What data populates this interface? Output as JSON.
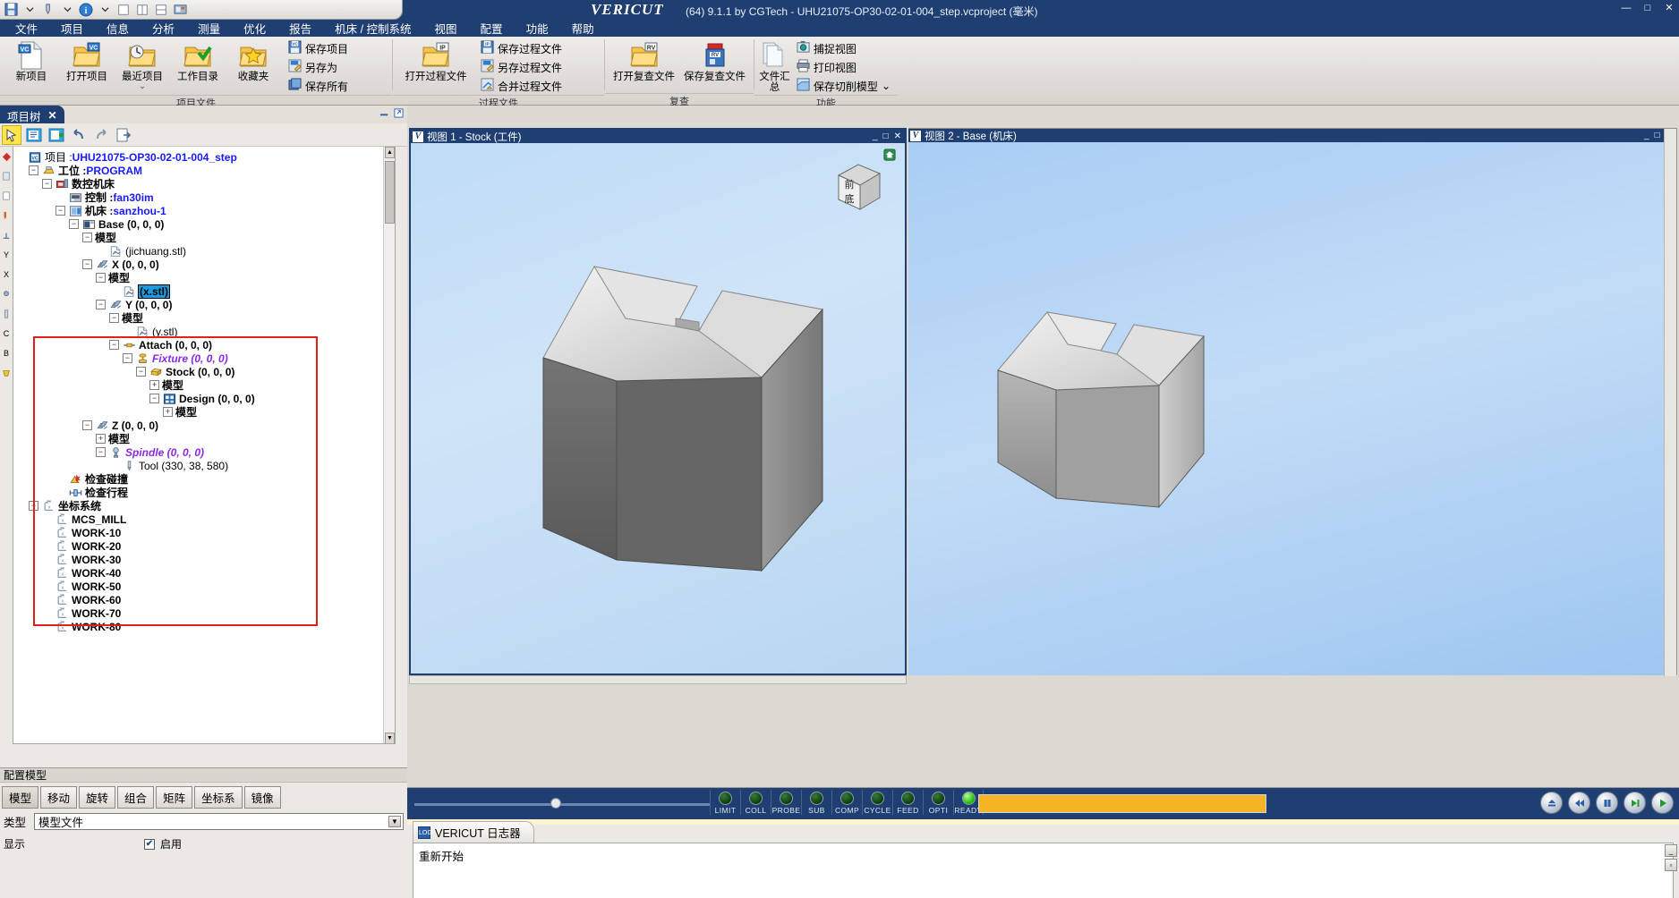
{
  "titlebar": {
    "brand": "VERICUT",
    "title": "(64) 9.1.1 by CGTech - UHU21075-OP30-02-01-004_step.vcproject (毫米)",
    "minimize": "—",
    "maximize": "□",
    "close": "✕"
  },
  "menubar": {
    "items": [
      {
        "label": "文件"
      },
      {
        "label": "项目"
      },
      {
        "label": "信息"
      },
      {
        "label": "分析"
      },
      {
        "label": "测量"
      },
      {
        "label": "优化"
      },
      {
        "label": "报告"
      },
      {
        "label": "机床 / 控制系统"
      },
      {
        "label": "视图"
      },
      {
        "label": "配置"
      },
      {
        "label": "功能"
      },
      {
        "label": "帮助"
      }
    ]
  },
  "ribbon": {
    "groups": [
      {
        "label": "项目文件",
        "big": [
          {
            "label": "新项目",
            "icon": "new-project-icon",
            "caret": false
          },
          {
            "label": "打开项目",
            "icon": "open-project-icon",
            "caret": false
          },
          {
            "label": "最近项目",
            "icon": "recent-project-icon",
            "caret": true
          },
          {
            "label": "工作目录",
            "icon": "work-directory-icon",
            "caret": false
          },
          {
            "label": "收藏夹",
            "icon": "favorites-icon",
            "caret": false
          }
        ],
        "small": [
          {
            "label": "保存项目",
            "icon": "save-project-icon"
          },
          {
            "label": "另存为",
            "icon": "save-as-icon"
          },
          {
            "label": "保存所有",
            "icon": "save-all-icon"
          }
        ]
      },
      {
        "label": "过程文件",
        "big": [
          {
            "label": "打开过程文件",
            "icon": "open-process-file-icon",
            "caret": false
          }
        ],
        "small": [
          {
            "label": "保存过程文件",
            "icon": "save-process-file-icon"
          },
          {
            "label": "另存过程文件",
            "icon": "save-as-process-file-icon"
          },
          {
            "label": "合并过程文件",
            "icon": "merge-process-file-icon"
          }
        ]
      },
      {
        "label": "复查",
        "big": [
          {
            "label": "打开复查文件",
            "icon": "open-review-file-icon",
            "caret": false
          },
          {
            "label": "保存复查文件",
            "icon": "save-review-file-icon",
            "caret": false
          }
        ],
        "small": []
      },
      {
        "label": "功能",
        "big": [
          {
            "label": "文件汇总",
            "icon": "file-summary-icon",
            "caret": false
          }
        ],
        "small": [
          {
            "label": "捕捉视图",
            "icon": "capture-view-icon"
          },
          {
            "label": "打印视图",
            "icon": "print-view-icon"
          },
          {
            "label": "保存切削模型",
            "icon": "save-cut-model-icon",
            "caret": true
          }
        ]
      }
    ]
  },
  "leftdock": {
    "tab_label": "项目树",
    "tab_close": "✕",
    "toolbar": [
      {
        "name": "pointer-tool-icon"
      },
      {
        "name": "edit-document-icon"
      },
      {
        "name": "add-document-icon"
      },
      {
        "name": "undo-icon"
      },
      {
        "name": "redo-icon"
      },
      {
        "name": "export-icon"
      }
    ],
    "tree": [
      {
        "indent": 0,
        "toggle": "",
        "icon": "project-icon",
        "label": "项目 : ",
        "value": "UHU21075-OP30-02-01-004_step",
        "style": "plain"
      },
      {
        "indent": 1,
        "toggle": "-",
        "icon": "setup-icon",
        "label": "工位 : ",
        "value": "PROGRAM",
        "style": "bold"
      },
      {
        "indent": 2,
        "toggle": "-",
        "icon": "machine-icon",
        "label": "数控机床",
        "value": "",
        "style": "bold"
      },
      {
        "indent": 3,
        "toggle": "",
        "icon": "control-icon",
        "label": "控制 : ",
        "value": "fan30im",
        "style": "bold"
      },
      {
        "indent": 3,
        "toggle": "-",
        "icon": "tool-machine-icon",
        "label": "机床 : ",
        "value": "sanzhou-1",
        "style": "bold"
      },
      {
        "indent": 4,
        "toggle": "-",
        "icon": "base-icon",
        "label": "Base (0, 0, 0)",
        "value": "",
        "style": "bold"
      },
      {
        "indent": 5,
        "toggle": "-",
        "icon": "",
        "label": "模型",
        "value": "",
        "style": "bold"
      },
      {
        "indent": 6,
        "toggle": "",
        "icon": "stl-file-icon",
        "label": "(jichuang.stl)",
        "value": "",
        "style": "plain"
      },
      {
        "indent": 5,
        "toggle": "-",
        "icon": "axis-icon",
        "label": "X (0, 0, 0)",
        "value": "",
        "style": "bold"
      },
      {
        "indent": 6,
        "toggle": "-",
        "icon": "",
        "label": "模型",
        "value": "",
        "style": "bold"
      },
      {
        "indent": 7,
        "toggle": "",
        "icon": "stl-file-icon",
        "label": "(x.stl)",
        "value": "",
        "style": "selected"
      },
      {
        "indent": 6,
        "toggle": "-",
        "icon": "axis-icon",
        "label": "Y (0, 0, 0)",
        "value": "",
        "style": "bold"
      },
      {
        "indent": 7,
        "toggle": "-",
        "icon": "",
        "label": "模型",
        "value": "",
        "style": "bold"
      },
      {
        "indent": 8,
        "toggle": "",
        "icon": "stl-file-icon",
        "label": "(y.stl)",
        "value": "",
        "style": "plain"
      },
      {
        "indent": 7,
        "toggle": "-",
        "icon": "attach-icon",
        "label": "Attach (0, 0, 0)",
        "value": "",
        "style": "bold"
      },
      {
        "indent": 8,
        "toggle": "-",
        "icon": "fixture-icon",
        "label": "Fixture (0, 0, 0)",
        "value": "",
        "style": "purple"
      },
      {
        "indent": 9,
        "toggle": "-",
        "icon": "stock-icon",
        "label": "Stock (0, 0, 0)",
        "value": "",
        "style": "bold"
      },
      {
        "indent": 10,
        "toggle": "+",
        "icon": "",
        "label": "模型",
        "value": "",
        "style": "bold"
      },
      {
        "indent": 10,
        "toggle": "-",
        "icon": "design-icon",
        "label": "Design (0, 0, 0)",
        "value": "",
        "style": "bold"
      },
      {
        "indent": 11,
        "toggle": "+",
        "icon": "",
        "label": "模型",
        "value": "",
        "style": "bold"
      },
      {
        "indent": 5,
        "toggle": "-",
        "icon": "axis-icon",
        "label": "Z (0, 0, 0)",
        "value": "",
        "style": "bold"
      },
      {
        "indent": 6,
        "toggle": "+",
        "icon": "",
        "label": "模型",
        "value": "",
        "style": "bold"
      },
      {
        "indent": 6,
        "toggle": "-",
        "icon": "spindle-icon",
        "label": "Spindle (0, 0, 0)",
        "value": "",
        "style": "purple"
      },
      {
        "indent": 7,
        "toggle": "",
        "icon": "tool-icon",
        "label": "Tool (330, 38, 580)",
        "value": "",
        "style": "plain"
      },
      {
        "indent": 3,
        "toggle": "",
        "icon": "collision-icon",
        "label": "检查碰撞",
        "value": "",
        "style": "bold"
      },
      {
        "indent": 3,
        "toggle": "",
        "icon": "travel-icon",
        "label": "检查行程",
        "value": "",
        "style": "bold"
      },
      {
        "indent": 1,
        "toggle": "-",
        "icon": "csys-icon",
        "label": "坐标系统",
        "value": "",
        "style": "bold"
      },
      {
        "indent": 2,
        "toggle": "",
        "icon": "csys-icon",
        "label": "MCS_MILL",
        "value": "",
        "style": "bold"
      },
      {
        "indent": 2,
        "toggle": "",
        "icon": "csys-icon",
        "label": "WORK-10",
        "value": "",
        "style": "bold"
      },
      {
        "indent": 2,
        "toggle": "",
        "icon": "csys-icon",
        "label": "WORK-20",
        "value": "",
        "style": "bold"
      },
      {
        "indent": 2,
        "toggle": "",
        "icon": "csys-icon",
        "label": "WORK-30",
        "value": "",
        "style": "bold"
      },
      {
        "indent": 2,
        "toggle": "",
        "icon": "csys-icon",
        "label": "WORK-40",
        "value": "",
        "style": "bold"
      },
      {
        "indent": 2,
        "toggle": "",
        "icon": "csys-icon",
        "label": "WORK-50",
        "value": "",
        "style": "bold"
      },
      {
        "indent": 2,
        "toggle": "",
        "icon": "csys-icon",
        "label": "WORK-60",
        "value": "",
        "style": "bold"
      },
      {
        "indent": 2,
        "toggle": "",
        "icon": "csys-icon",
        "label": "WORK-70",
        "value": "",
        "style": "bold"
      },
      {
        "indent": 2,
        "toggle": "",
        "icon": "csys-icon",
        "label": "WORK-80",
        "value": "",
        "style": "bold"
      }
    ]
  },
  "config_panel": {
    "title": "配置模型",
    "tabs": [
      {
        "label": "模型",
        "active": true
      },
      {
        "label": "移动",
        "active": false
      },
      {
        "label": "旋转",
        "active": false
      },
      {
        "label": "组合",
        "active": false
      },
      {
        "label": "矩阵",
        "active": false
      },
      {
        "label": "坐标系",
        "active": false
      },
      {
        "label": "镜像",
        "active": false
      }
    ],
    "type_label": "类型",
    "type_value": "模型文件",
    "display_label": "显示",
    "enable_label": "启用",
    "enable_checked": "✔"
  },
  "views": [
    {
      "name": "view-1",
      "logo": "V",
      "title": "视图 1 - Stock (工件)",
      "controls": {
        "minimize": "_",
        "maximize": "□",
        "close": "✕"
      },
      "viewcube": {
        "front": "前",
        "bottom": "底"
      },
      "home_icon": "home-icon"
    },
    {
      "name": "view-2",
      "logo": "V",
      "title": "视图 2 - Base (机床)",
      "controls": {
        "minimize": "_",
        "maximize": "□",
        "close": "✕"
      },
      "viewcube": null,
      "home_icon": null
    }
  ],
  "statusbar": {
    "leds": [
      {
        "label": "LIMIT",
        "on": false
      },
      {
        "label": "COLL",
        "on": false
      },
      {
        "label": "PROBE",
        "on": false
      },
      {
        "label": "SUB",
        "on": false
      },
      {
        "label": "COMP",
        "on": false
      },
      {
        "label": "CYCLE",
        "on": false
      },
      {
        "label": "FEED",
        "on": false
      },
      {
        "label": "OPTI",
        "on": false
      },
      {
        "label": "READY",
        "on": true
      }
    ],
    "progress_bar_color": "#f5b423",
    "buttons": [
      {
        "name": "reset-button",
        "glyph": "⏏"
      },
      {
        "name": "rewind-button",
        "glyph": "⏪"
      },
      {
        "name": "pause-button",
        "glyph": "⏸"
      },
      {
        "name": "step-button",
        "glyph": "⏭"
      },
      {
        "name": "play-button",
        "glyph": "▶"
      }
    ]
  },
  "logpanel": {
    "tab_label": "VERICUT 日志器",
    "tab_icon": "LOG",
    "message": "重新开始"
  },
  "colors": {
    "titlebar": "#1f3f73",
    "accent_selected": "#1a9ae0",
    "redbox": "#e32119",
    "led_on": "#29c20a",
    "progress": "#f5b423",
    "tree_link": "#1a1aff",
    "tree_purple": "#8a2be2"
  }
}
